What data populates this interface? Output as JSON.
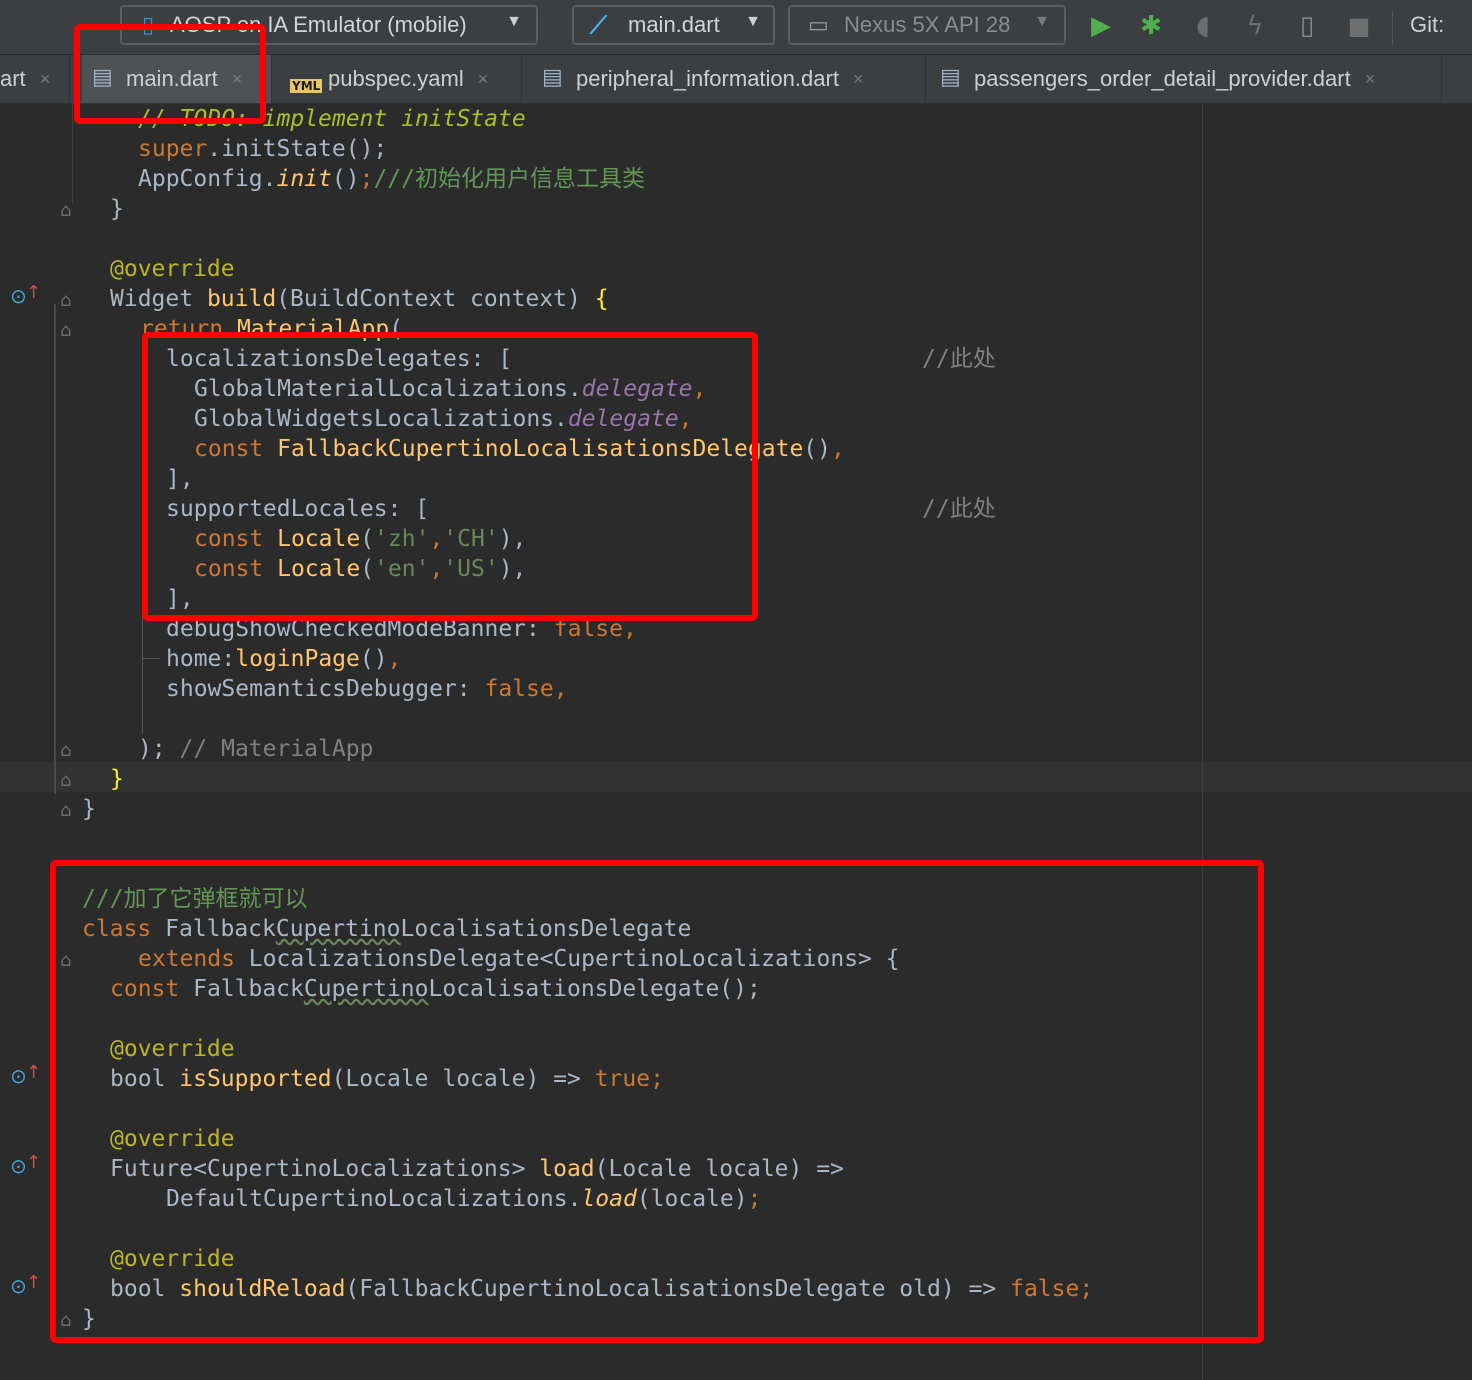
{
  "toolbar": {
    "device_config": "AOSP on IA Emulator (mobile)",
    "run_config": "main.dart",
    "avd": "Nexus 5X API 28",
    "git_label": "Git:"
  },
  "tabs": [
    {
      "label": "art"
    },
    {
      "label": "main.dart"
    },
    {
      "label": "pubspec.yaml"
    },
    {
      "label": "peripheral_information.dart"
    },
    {
      "label": "passengers_order_detail_provider.dart"
    }
  ],
  "icons": {
    "yaml_badge": "YML",
    "close": "×"
  },
  "code": {
    "l0_comment": "// TODO: implement initState",
    "l1_super": "super",
    "l1_dot_init": ".initState();",
    "l2_appconfig": "AppConfig.",
    "l2_init": "init",
    "l2_parens": "()",
    "l2_semi": ";",
    "l2_comment": "///初始化用户信息工具类",
    "l3": "}",
    "l5_ann": "@override",
    "l6_widget": "Widget ",
    "l6_build": "build",
    "l6_params": "(BuildContext context) ",
    "l6_brace": "{",
    "l7_return": "return ",
    "l7_material": "MaterialApp",
    "l7_paren": "(",
    "l8_key": "localizationsDelegates: [",
    "l8_comment": "//此处",
    "l9_class": "GlobalMaterialLocalizations.",
    "l9_prop": "delegate",
    "l9_comma": ",",
    "l10_class": "GlobalWidgetsLocalizations.",
    "l10_prop": "delegate",
    "l10_comma": ",",
    "l11_const": "const ",
    "l11_ctor": "FallbackCupertinoLocalisationsDelegate",
    "l11_parens": "()",
    "l11_comma": ",",
    "l12": "],",
    "l13_key": "supportedLocales: [",
    "l13_comment": "//此处",
    "l14_const": "const ",
    "l14_ctor": "Locale",
    "l14_open": "(",
    "l14_s1": "'zh'",
    "l14_comma1": ",",
    "l14_s2": "'CH'",
    "l14_close": "),",
    "l15_const": "const ",
    "l15_ctor": "Locale",
    "l15_open": "(",
    "l15_s1": "'en'",
    "l15_comma1": ",",
    "l15_s2": "'US'",
    "l15_close": "),",
    "l16": "],",
    "l17_key": "debugShowCheckedModeBanner: ",
    "l17_val": "false",
    "l17_comma": ",",
    "l18_key": "home:",
    "l18_fn": "loginPage",
    "l18_parens": "()",
    "l18_comma": ",",
    "l19_key": "showSemanticsDebugger: ",
    "l19_val": "false",
    "l19_comma": ",",
    "l21_close": ");",
    "l21_comment": " // MaterialApp",
    "l22": "}",
    "l23": "}",
    "l26_comment": "///加了它弹框就可以",
    "l27_class": "class ",
    "l27_name1": "Fallback",
    "l27_name2": "Cupertino",
    "l27_name3": "LocalisationsDelegate",
    "l28_extends": "extends ",
    "l28_type": "LocalizationsDelegate<CupertinoLocalizations> {",
    "l29_const": "const ",
    "l29_name1": "Fallback",
    "l29_name2": "Cupertino",
    "l29_name3": "LocalisationsDelegate();",
    "l31_ann": "@override",
    "l32_bool": "bool ",
    "l32_fn": "isSupported",
    "l32_params": "(Locale locale) => ",
    "l32_val": "true",
    "l32_semi": ";",
    "l34_ann": "@override",
    "l35_type": "Future<CupertinoLocalizations> ",
    "l35_fn": "load",
    "l35_params": "(Locale locale) =>",
    "l36_class": "DefaultCupertinoLocalizations.",
    "l36_fn": "load",
    "l36_params": "(locale)",
    "l36_semi": ";",
    "l38_ann": "@override",
    "l39_bool": "bool ",
    "l39_fn": "shouldReload",
    "l39_params": "(FallbackCupertinoLocalisationsDelegate old) => ",
    "l39_val": "false",
    "l39_semi": ";",
    "l40": "}"
  }
}
